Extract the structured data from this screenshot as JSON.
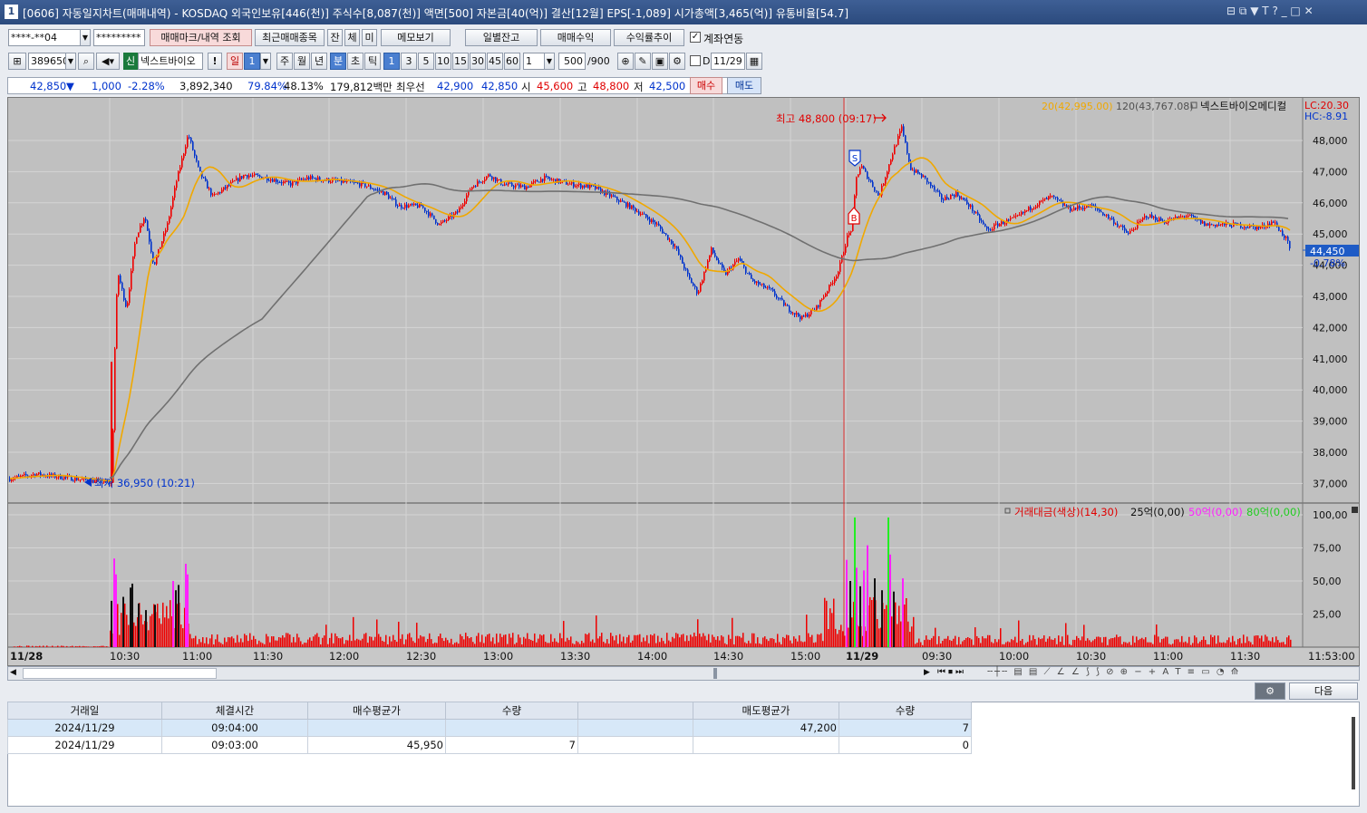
{
  "titlebar": {
    "number": "1",
    "text": "[0606] 자동일지차트(매매내역) - KOSDAQ 외국인보유[446(천)] 주식수[8,087(천)] 액면[500] 자본금[40(억)] 결산[12월] EPS[-1,089] 시가총액[3,465(억)] 유통비율[54.7]",
    "controls": "⊟ ⧉ ▼ T ? _ □ ✕"
  },
  "toolbar1": {
    "account": "****-**04",
    "password": "*********",
    "btn_mark": "매매마크/내역 조회",
    "btn_recent": "최근매매종목",
    "btn_jan": "잔",
    "btn_che": "체",
    "btn_mi": "미",
    "btn_memo": "메모보기",
    "btn_daily": "일별잔고",
    "btn_profit": "매매수익",
    "btn_rate": "수익률추이",
    "acct_link_label": "계좌연동"
  },
  "toolbar2": {
    "code": "389650",
    "badge": "신",
    "name": "넥스트바이오",
    "btn_excl": "!",
    "btn_day": "일",
    "day_n": "1",
    "btn_week": "주",
    "btn_month": "월",
    "btn_year": "년",
    "btn_min": "분",
    "btn_sec": "초",
    "btn_tick": "틱",
    "min_options": [
      "1",
      "3",
      "5",
      "10",
      "15",
      "30",
      "45",
      "60"
    ],
    "period_n": "1",
    "count": "500",
    "count_max": "/900",
    "d_label": "D",
    "date": "11/29"
  },
  "quote": {
    "price": "42,850",
    "arrow": "▼",
    "change": "1,000",
    "pct": "-2.28%",
    "volume": "3,892,340",
    "ratio1": "79.84%",
    "ratio2": "48.13%",
    "amount": "179,812백만",
    "best_label": "최우선",
    "ask": "42,900",
    "bid": "42,850",
    "open_label": "시",
    "open": "45,600",
    "high_label": "고",
    "high": "48,800",
    "low_label": "저",
    "low": "42,500",
    "btn_buy": "매수",
    "btn_sell": "매도"
  },
  "chart_legend": {
    "ma20": "20(42,995.00)",
    "ma120": "120(43,767.08)",
    "name": "넥스트바이오메디컬",
    "lc": "LC:20.30",
    "hc": "HC:-8.91",
    "hi_label": "최고 48,800 (09:17)",
    "lo_label": "최저 36,950 (10:21)",
    "cur_price": "44,450",
    "cur_pct": "-0.78%",
    "mark_s": "S",
    "mark_b": "B"
  },
  "vol_legend": {
    "title": "거래대금(색상)(14,30)",
    "l25": "25억(0,00)",
    "l50": "50억(0,00)",
    "l80": "80억(0,00)"
  },
  "colors": {
    "up": "#ee0000",
    "down": "#0033cc",
    "ma20": "#f0a800",
    "ma120": "#707070",
    "pink": "#ff22ff",
    "green": "#22ee22"
  },
  "chart_data": {
    "type": "candlestick",
    "price_axis": [
      "48,000",
      "47,000",
      "46,000",
      "45,000",
      "44,000",
      "43,000",
      "42,000",
      "41,000",
      "40,000",
      "39,000",
      "38,000",
      "37,000"
    ],
    "price_values": [
      48000,
      47000,
      46000,
      45000,
      44000,
      43000,
      42000,
      41000,
      40000,
      39000,
      38000,
      37000
    ],
    "vol_axis": [
      "100,00",
      "75,00",
      "50,00",
      "25,00"
    ],
    "vol_values": [
      100,
      75,
      50,
      25
    ],
    "time_labels": [
      "11/28",
      "10:30",
      "11:00",
      "11:30",
      "12:00",
      "12:30",
      "13:00",
      "13:30",
      "14:00",
      "14:30",
      "15:00",
      "11/29",
      "09:30",
      "10:00",
      "10:30",
      "11:00",
      "11:30",
      "11:53:00"
    ]
  },
  "grid": {
    "headers": [
      "거래일",
      "체결시간",
      "매수평균가",
      "수량",
      "",
      "매도평균가",
      "수량"
    ],
    "rows": [
      [
        "2024/11/29",
        "09:04:00",
        "",
        "",
        "",
        "47,200",
        "7"
      ],
      [
        "2024/11/29",
        "09:03:00",
        "45,950",
        "7",
        "",
        "",
        "0"
      ]
    ],
    "btn_next": "다음"
  }
}
